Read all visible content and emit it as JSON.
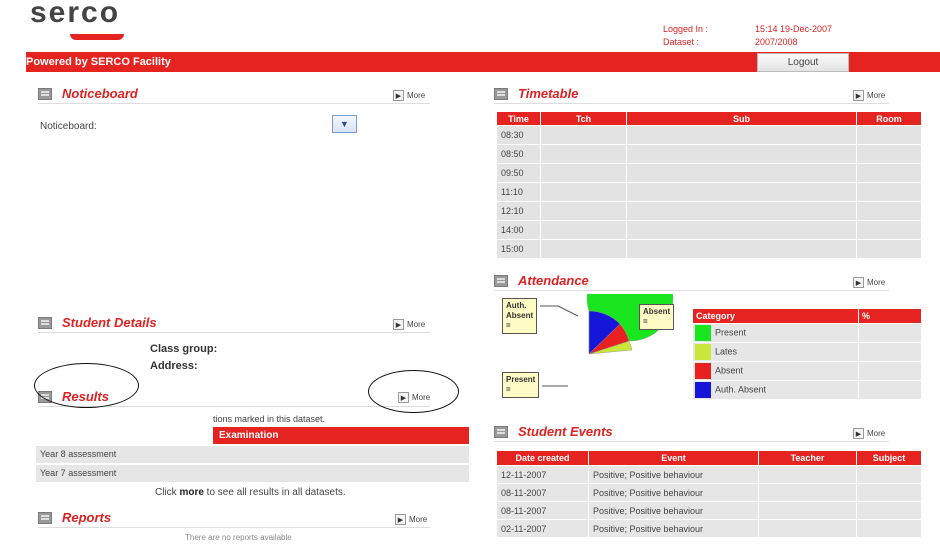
{
  "header": {
    "logo_text": "serco",
    "logged_in_label": "Logged In :",
    "logged_in_value": "15:14 19-Dec-2007",
    "dataset_label": "Dataset :",
    "dataset_value": "2007/2008",
    "powered_by": "Powered by SERCO Facility",
    "logout_label": "Logout"
  },
  "more_label": "More",
  "noticeboard": {
    "title": "Noticeboard",
    "label": "Noticeboard:"
  },
  "student_details": {
    "title": "Student Details",
    "class_group_label": "Class group:",
    "address_label": "Address:"
  },
  "results": {
    "title": "Results",
    "partial_text": "tions marked in this dataset.",
    "column_header": "Examination",
    "rows": [
      "Year 8 assessment",
      "Year 7 assessment"
    ],
    "note_prefix": "Click ",
    "note_bold": "more",
    "note_suffix": " to see all results in all datasets."
  },
  "reports": {
    "title": "Reports",
    "partial_text": "There are no reports available"
  },
  "timetable": {
    "title": "Timetable",
    "columns": [
      "Time",
      "Tch",
      "Sub",
      "Room"
    ],
    "times": [
      "08:30",
      "08:50",
      "09:50",
      "11:10",
      "12:10",
      "14:00",
      "15:00"
    ]
  },
  "attendance": {
    "title": "Attendance",
    "legend_headers": [
      "Category",
      "%"
    ],
    "categories": [
      {
        "name": "Present",
        "color": "#19e61e"
      },
      {
        "name": "Lates",
        "color": "#c9e63a"
      },
      {
        "name": "Absent",
        "color": "#e8201f"
      },
      {
        "name": "Auth. Absent",
        "color": "#1616d8"
      }
    ],
    "callouts": {
      "auth_absent": [
        "Auth.",
        "Absent",
        "="
      ],
      "absent": [
        "Absent",
        "="
      ],
      "present": [
        "Present",
        "="
      ]
    }
  },
  "student_events": {
    "title": "Student Events",
    "columns": [
      "Date created",
      "Event",
      "Teacher",
      "Subject"
    ],
    "rows": [
      {
        "date": "12-11-2007",
        "event": "Positive; Positive behaviour"
      },
      {
        "date": "08-11-2007",
        "event": "Positive; Positive behaviour"
      },
      {
        "date": "08-11-2007",
        "event": "Positive; Positive behaviour"
      },
      {
        "date": "02-11-2007",
        "event": "Positive; Positive behaviour"
      }
    ]
  }
}
